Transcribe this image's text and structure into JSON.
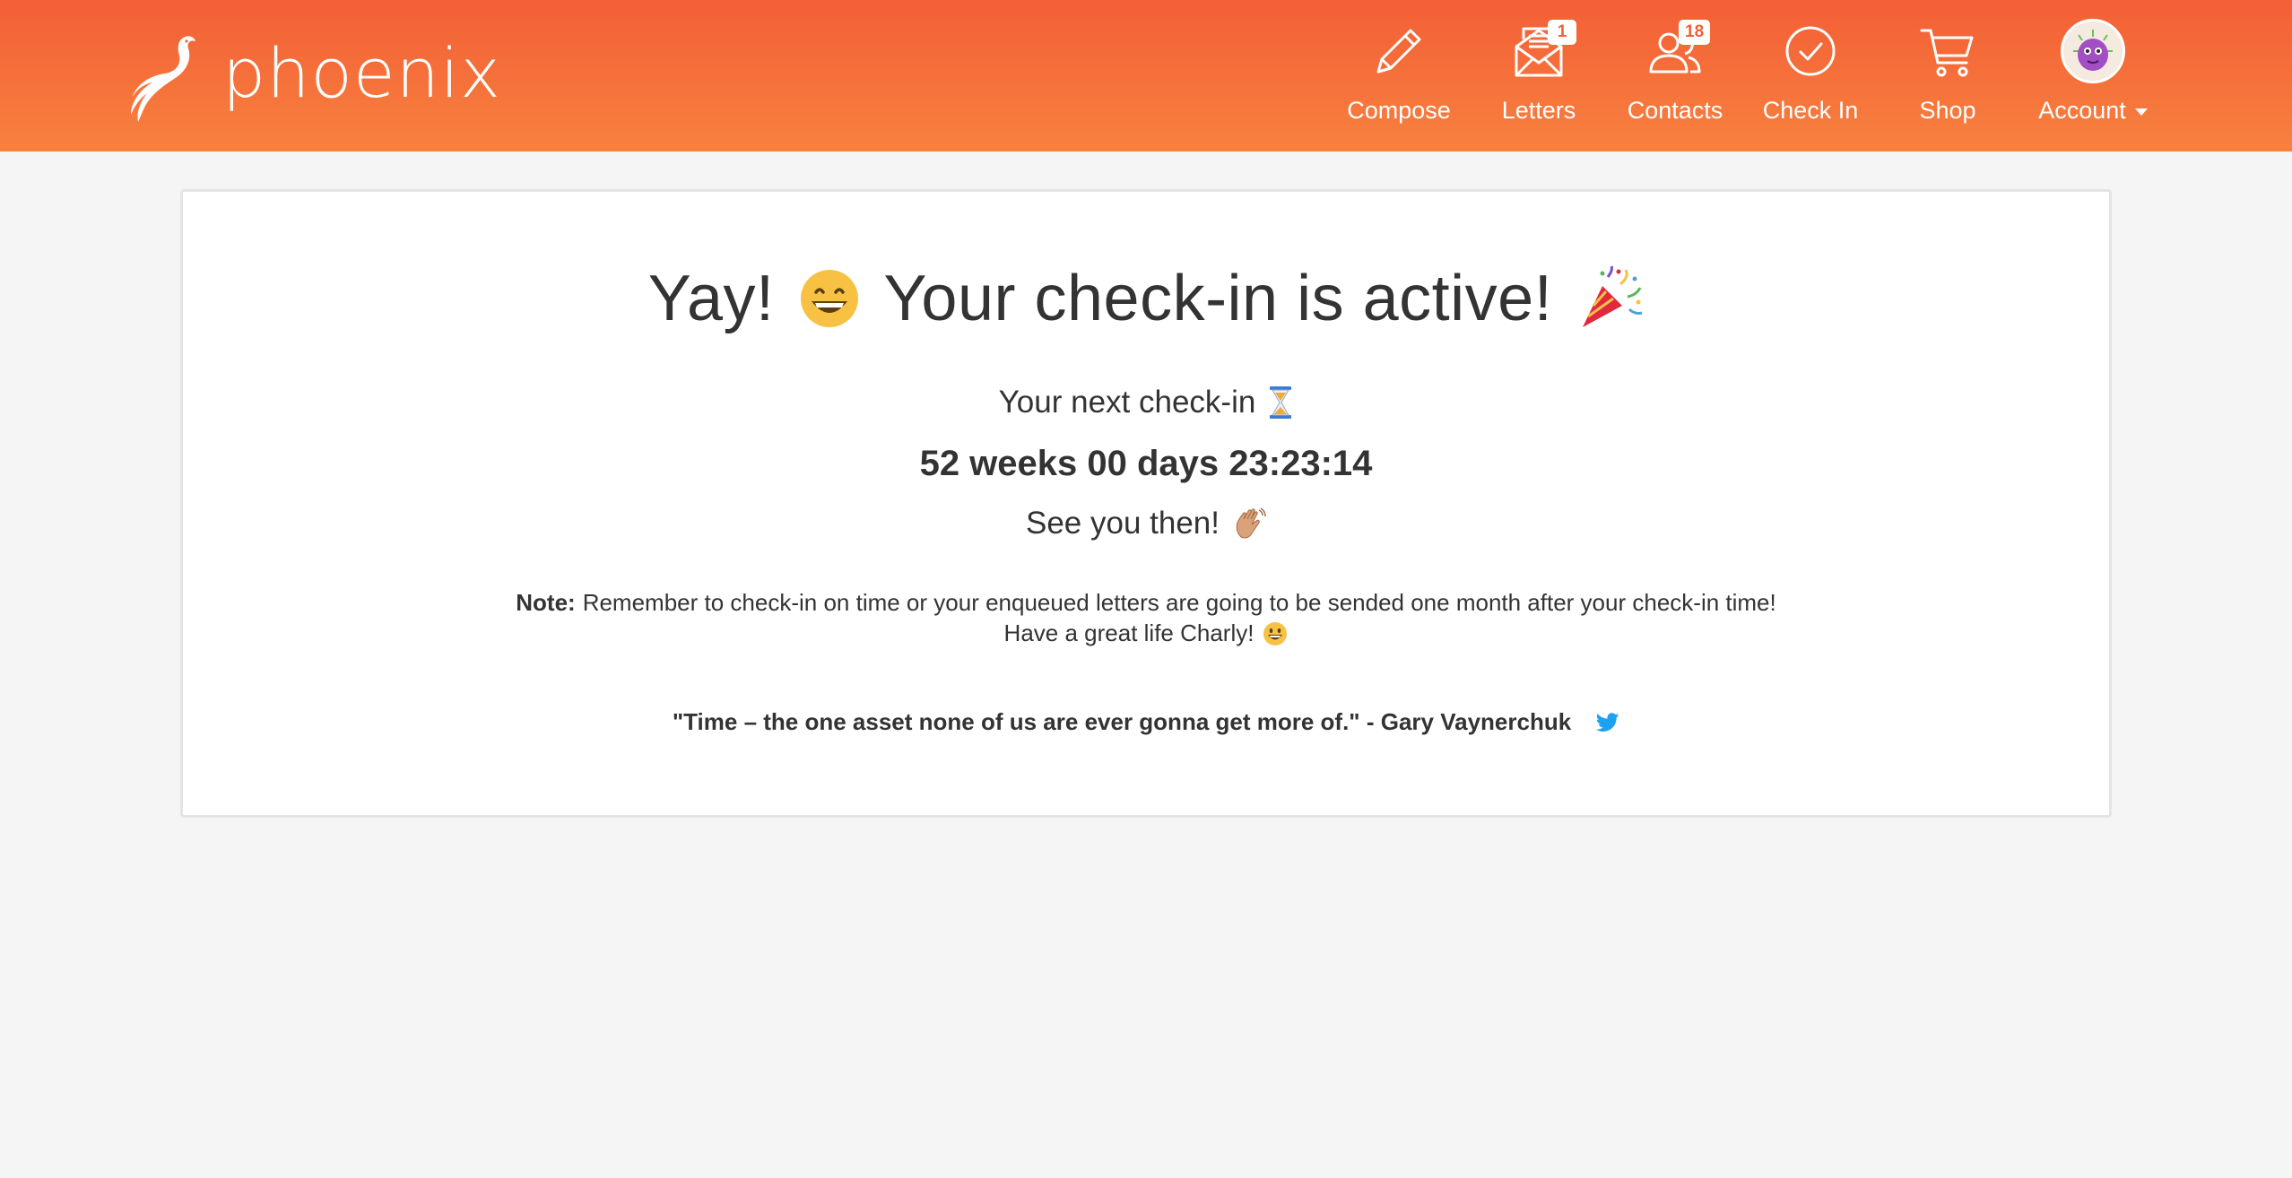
{
  "brand": {
    "name": "phoenix"
  },
  "nav": {
    "compose": {
      "label": "Compose",
      "icon": "pencil-icon"
    },
    "letters": {
      "label": "Letters",
      "icon": "envelope-icon",
      "badge": "1"
    },
    "contacts": {
      "label": "Contacts",
      "icon": "contacts-icon",
      "badge": "18"
    },
    "checkin": {
      "label": "Check In",
      "icon": "check-circle-icon"
    },
    "shop": {
      "label": "Shop",
      "icon": "cart-icon"
    },
    "account": {
      "label": "Account",
      "icon": "avatar"
    }
  },
  "main": {
    "title_before": "Yay!",
    "title_after": "Your check-in is active!",
    "next_label": "Your next check-in",
    "countdown": "52 weeks 00 days 23:23:14",
    "see_you": "See you then!",
    "note_label": "Note:",
    "note_text": "Remember to check-in on time or your enqueued letters are going to be sended one month after your check-in time!",
    "greeting": "Have a great life Charly!",
    "quote": "\"Time – the one asset none of us are ever gonna get more of.\" - Gary Vaynerchuk"
  },
  "colors": {
    "header_top": "#f35f36",
    "header_bottom": "#f7813f",
    "background": "#f5f5f5",
    "text": "#333333",
    "twitter": "#1da1f2"
  }
}
